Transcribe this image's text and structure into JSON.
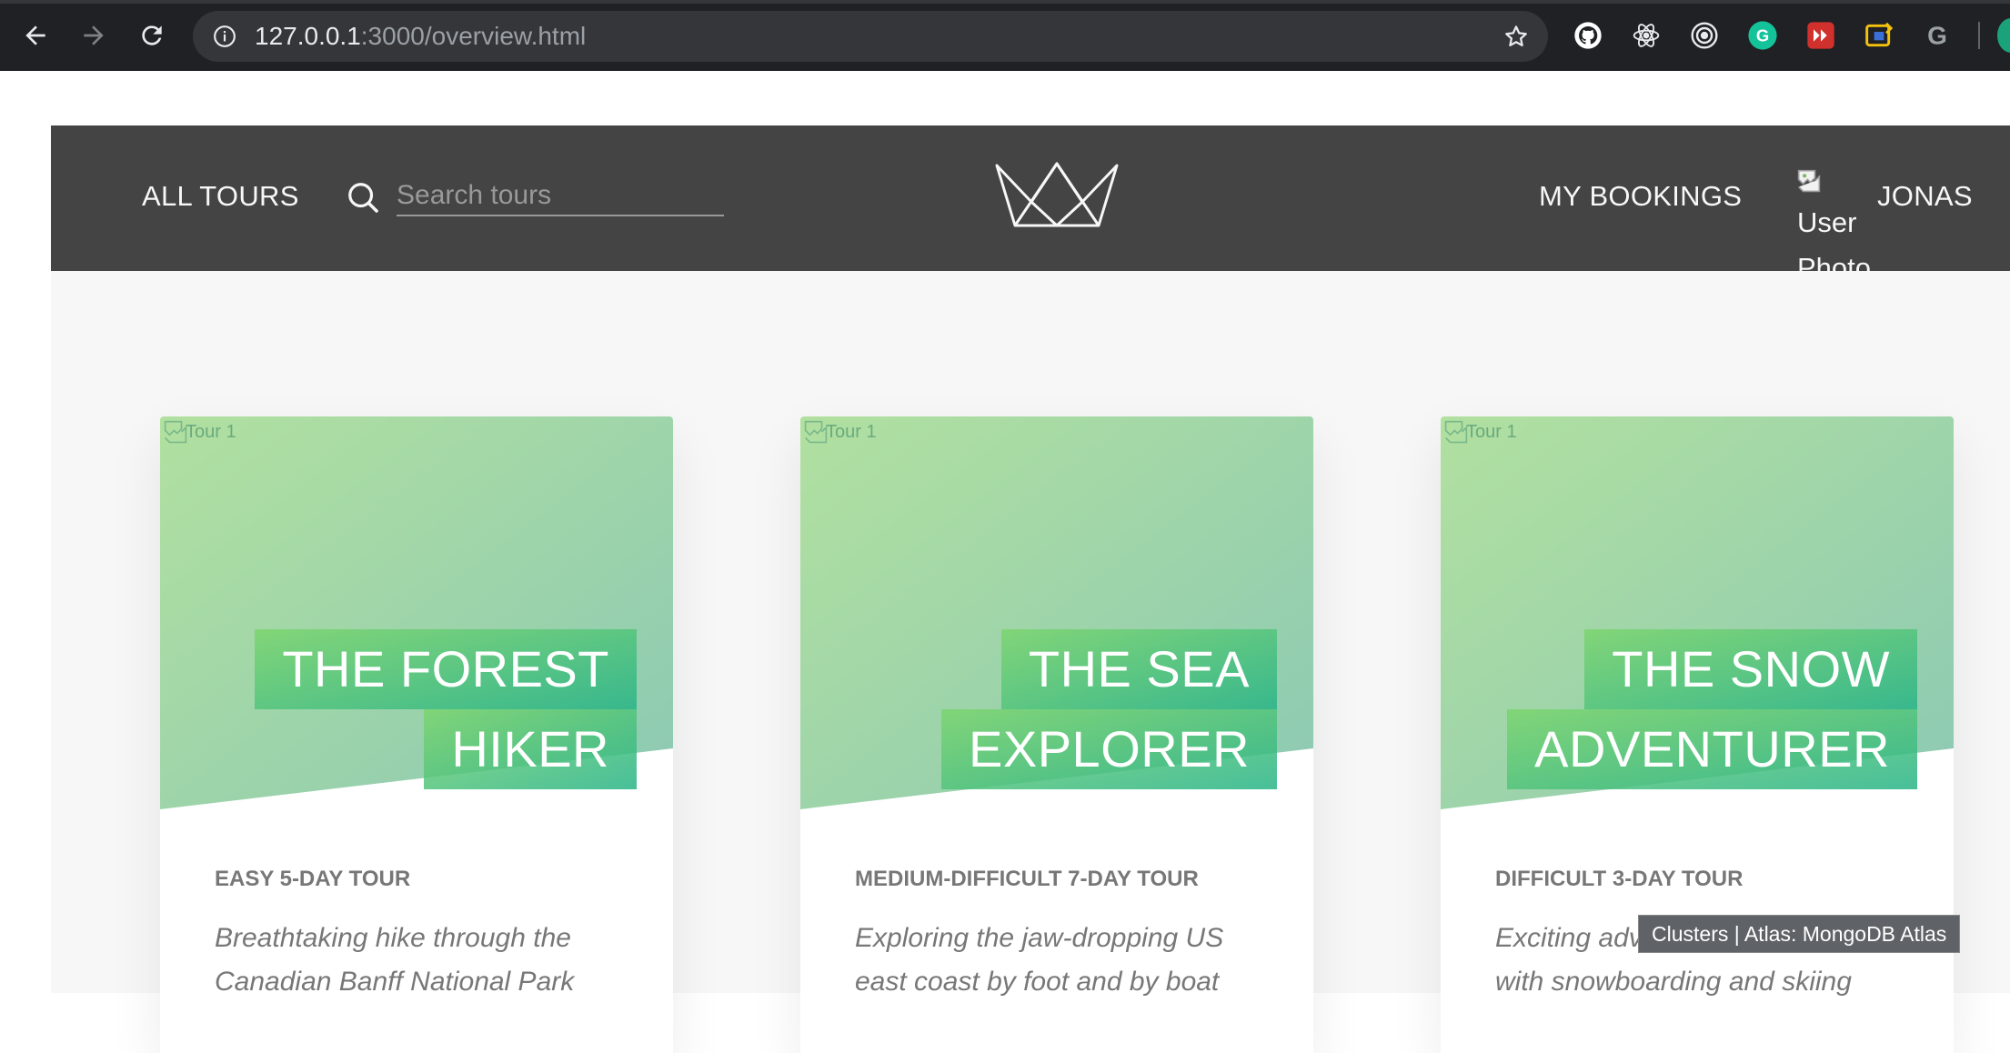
{
  "browser": {
    "url_host": "127.0.0.1",
    "url_rest": ":3000/overview.html",
    "extensions": [
      "github-icon",
      "react-devtools-icon",
      "target-icon",
      "grammarly-icon",
      "red-extension-icon",
      "yellow-extension-icon",
      "google-icon"
    ]
  },
  "header": {
    "all_tours": "All tours",
    "search_placeholder": "Search tours",
    "my_bookings": "My bookings",
    "user_photo_alt": "User\nPhoto",
    "user_name": "Jonas"
  },
  "cards": [
    {
      "image_alt": "Tour 1",
      "title_line1": "The Forest",
      "title_line2": "Hiker",
      "subheading": "Easy 5-day tour",
      "summary": "Breathtaking hike through the Canadian Banff National Park"
    },
    {
      "image_alt": "Tour 1",
      "title_line1": "The Sea",
      "title_line2": "Explorer",
      "subheading": "Medium-difficult 7-day tour",
      "summary": "Exploring the jaw-dropping US east coast by foot and by boat"
    },
    {
      "image_alt": "Tour 1",
      "title_line1": "The Snow",
      "title_line2": "Adventurer",
      "subheading": "Difficult 3-day tour",
      "summary": "Exciting adventure in the snow with snowboarding and skiing"
    }
  ],
  "tooltip": "Clusters | Atlas: MongoDB Atlas",
  "colors": {
    "header_bg": "#444444",
    "page_bg": "#f7f7f7",
    "accent_green_light": "#7dd56f",
    "accent_green_dark": "#28b487"
  }
}
